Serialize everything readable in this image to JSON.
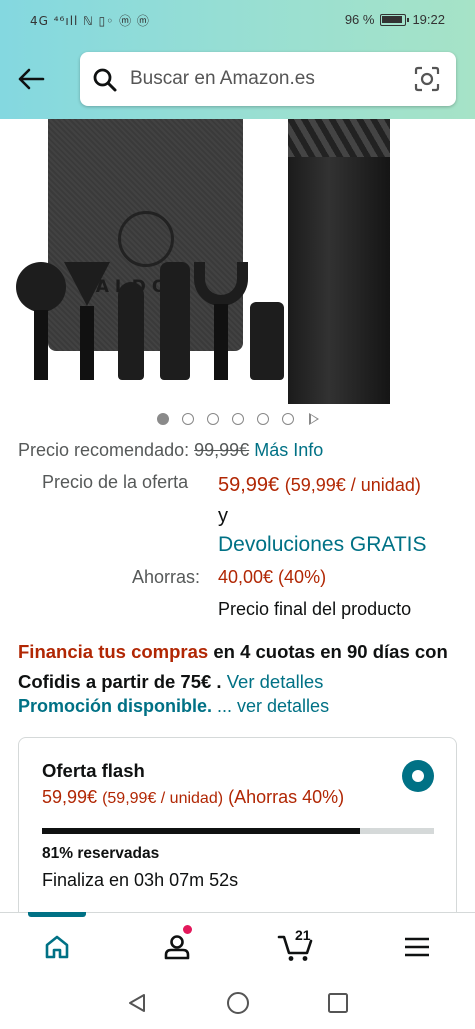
{
  "status_bar": {
    "left_icons": "4G ⁴⁶ıll ℕ ▯◦ ⓜ ⓜ",
    "battery_pct": "96 %",
    "time": "19:22"
  },
  "search": {
    "placeholder": "Buscar en Amazon.es"
  },
  "gallery": {
    "brand_text": "ALDOM",
    "dot_count": 6,
    "active_index": 0
  },
  "price": {
    "recommended_label": "Precio recomendado:",
    "recommended_value": "99,99€",
    "more_info": "Más Info",
    "offer_label": "Precio de la oferta",
    "offer_value": "59,99€",
    "offer_unit": "(59,99€ / unidad)",
    "and": "y",
    "free_returns": "Devoluciones GRATIS",
    "savings_label": "Ahorras:",
    "savings_value": "40,00€ (40%)",
    "final_note": "Precio final del producto"
  },
  "financing": {
    "highlight": "Financia tus compras",
    "text": " en 4 cuotas en 90 días con Cofidis a partir de 75€",
    "sep": " . ",
    "link": "Ver detalles"
  },
  "promotion": {
    "label": "Promoción disponible.",
    "link": " ... ver detalles"
  },
  "flash_deal": {
    "title": "Oferta flash",
    "price": "59,99€",
    "unit": "(59,99€ / unidad)",
    "savings": "(Ahorras 40%)",
    "claimed_fraction": 0.81,
    "claimed_text": "81% reservadas",
    "ends_text": "Finaliza en 03h 07m 52s",
    "selected": true
  },
  "bottom_nav": {
    "items": [
      "home-icon",
      "account-icon",
      "cart-icon",
      "menu-icon"
    ],
    "cart_count": "21",
    "active": "home"
  },
  "colors": {
    "accent": "#007185",
    "price_red": "#b12704",
    "header_gradient_start": "#84d8e0",
    "header_gradient_end": "#a6e3c7"
  }
}
